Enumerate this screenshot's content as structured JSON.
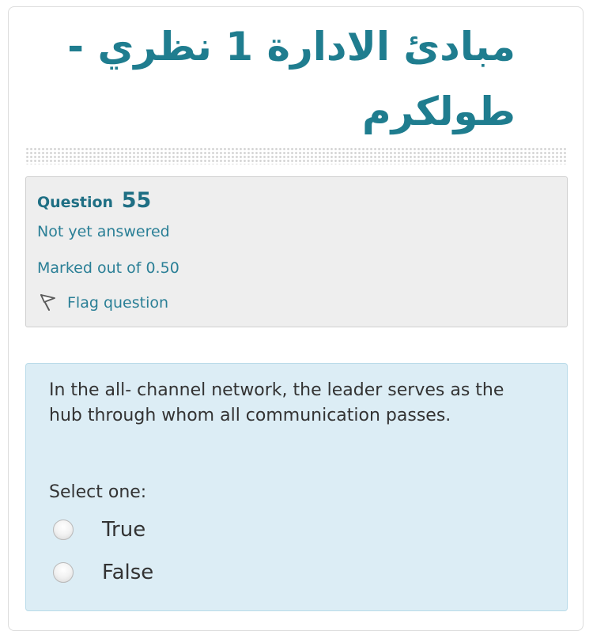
{
  "course": {
    "title": "مبادئ الادارة 1 نظري - طولكرم"
  },
  "question_info": {
    "label": "Question",
    "number": "55",
    "state": "Not yet answered",
    "grade": "Marked out of 0.50",
    "flag_label": "Flag question",
    "flag_icon": "flag-outline-icon"
  },
  "question": {
    "text": "In the all- channel network, the leader serves as the hub through whom all communication passes.",
    "prompt": "Select one:",
    "options": [
      {
        "label": "True",
        "selected": false
      },
      {
        "label": "False",
        "selected": false
      }
    ]
  },
  "colors": {
    "title": "#1f7d8f",
    "info_background": "#eeeeee",
    "link": "#2a7f96",
    "formulation_background": "#dcedf5",
    "formulation_border": "#b9dbe9"
  }
}
